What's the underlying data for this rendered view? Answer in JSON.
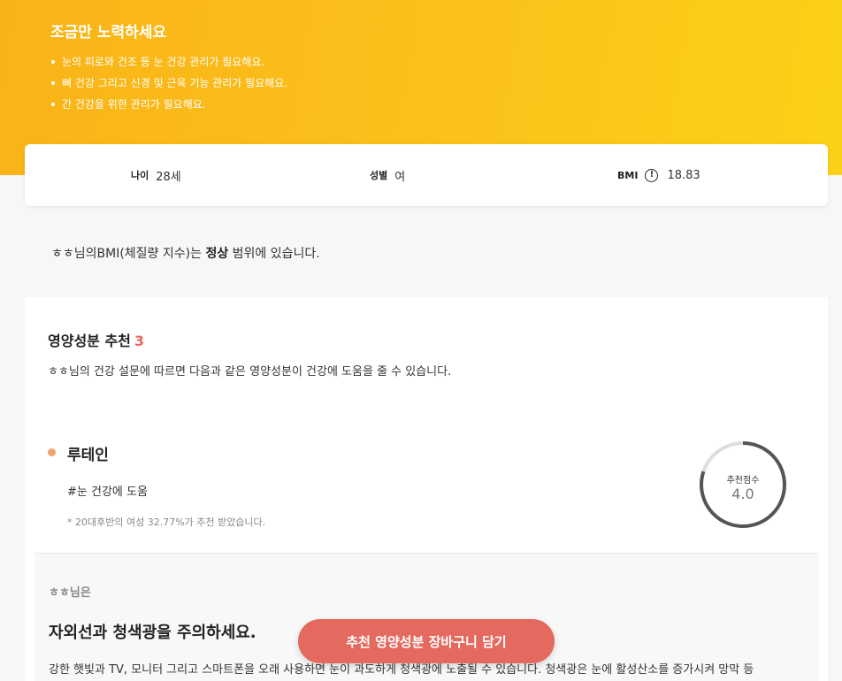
{
  "hero": {
    "title": "조금만 노력하세요",
    "items": [
      "눈의 피로와 건조 등 눈 건강 관리가 필요해요.",
      "뼈 건강 그리고 신경 및 근육 기능 관리가 필요해요.",
      "간 건강을 위한 관리가 필요해요."
    ]
  },
  "info": {
    "age_label": "나이",
    "age_value": "28세",
    "sex_label": "성별",
    "sex_value": "여",
    "bmi_label": "BMI",
    "bmi_icon_glyph": "!",
    "bmi_value": "18.83"
  },
  "bmi_sentence": {
    "prefix": "ㅎㅎ님의BMI(체질량 지수)는 ",
    "status": "정상",
    "suffix": " 범위에 있습니다."
  },
  "recommendation": {
    "title": "영양성분 추천",
    "count": "3",
    "description": "ㅎㅎ님의 건강 설문에 따르면 다음과 같은 영양성분이 건강에 도움을 줄 수 있습니다.",
    "nutrient": {
      "name": "루테인",
      "tag": "#눈 건강에 도움",
      "note": "* 20대후반의 여성 32.77%가 추천 받았습니다.",
      "score_label": "추천점수",
      "score_value": "4.0",
      "score_max": 5,
      "score": 4.0
    }
  },
  "caution": {
    "user": "ㅎㅎ님은",
    "title": "자외선과 청색광을 주의하세요.",
    "body": "강한 햇빛과 TV, 모니터 그리고 스마트폰을 오래 사용하면 눈이 과도하게 청색광에 노출될 수 있습니다. 청색광은 눈에 활성산소를 증가시켜 망막 등"
  },
  "cart_button_label": "추천 영양성분 장바구니 담기",
  "colors": {
    "hero_start": "#f9b318",
    "hero_end": "#fcd018",
    "accent": "#e46a5f",
    "nutrient_dot": "#f0a36b",
    "ring": "#555555"
  },
  "icons": {
    "bmi_info": "alert-circle-icon",
    "list_bullet": "dot-bullet-icon"
  }
}
